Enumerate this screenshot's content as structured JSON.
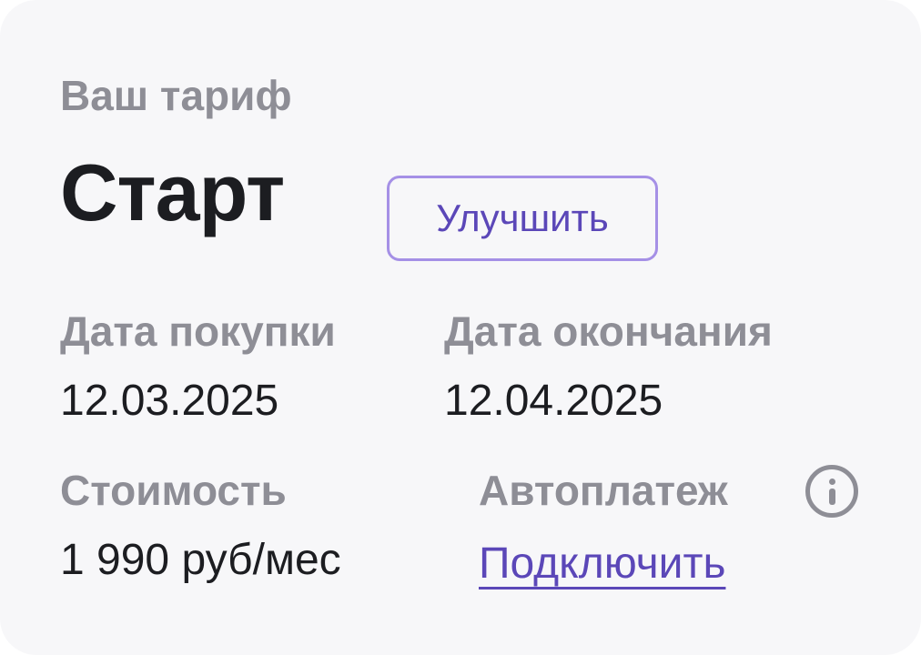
{
  "header": {
    "label": "Ваш тариф",
    "plan_name": "Старт",
    "upgrade_label": "Улучшить"
  },
  "purchase": {
    "label": "Дата покупки",
    "value": "12.03.2025"
  },
  "expiry": {
    "label": "Дата окончания",
    "value": "12.04.2025"
  },
  "price": {
    "label": "Стоимость",
    "value": "1 990 руб/мес"
  },
  "autopay": {
    "label": "Автоплатеж",
    "info_icon": "info-icon",
    "connect_label": "Подключить"
  },
  "colors": {
    "accent": "#5b47b8",
    "accent_border": "#a590e6",
    "muted_text": "#8e8e96",
    "primary_text": "#1c1d21",
    "card_background": "#f7f7f9"
  }
}
